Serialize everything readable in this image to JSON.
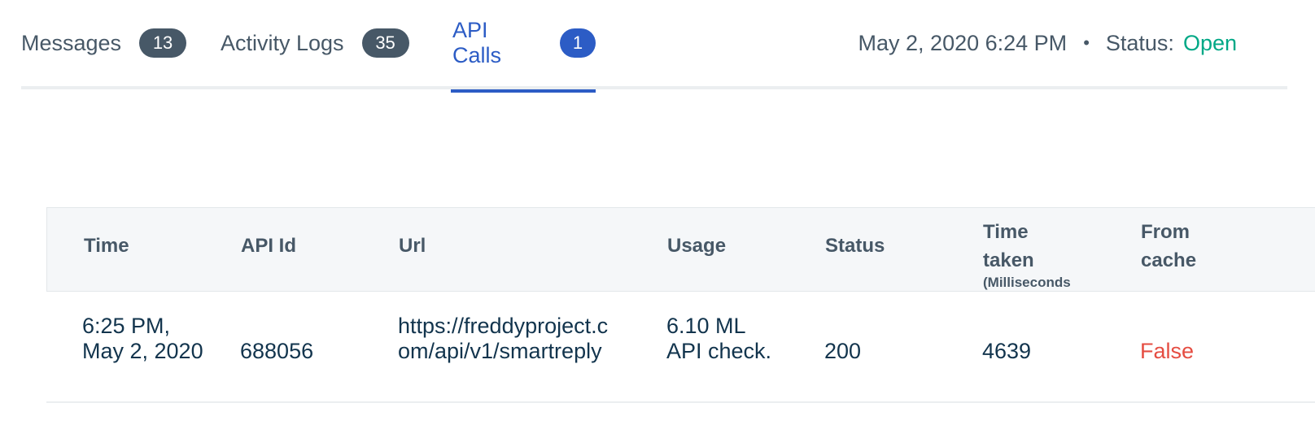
{
  "tabs": [
    {
      "label": "Messages",
      "count": "13"
    },
    {
      "label": "Activity Logs",
      "count": "35"
    },
    {
      "label": "API Calls",
      "count": "1"
    }
  ],
  "active_tab": "API Calls",
  "meta": {
    "datetime": "May 2, 2020 6:24 PM",
    "separator": "•",
    "status_label": "Status:",
    "status_value": "Open"
  },
  "colors": {
    "accent": "#2c5cc5",
    "status_open": "#00a886",
    "false_value": "#e54d42",
    "badge": "#475867"
  },
  "table": {
    "headers": {
      "time": "Time",
      "api_id": "API Id",
      "url": "Url",
      "usage": "Usage",
      "status": "Status",
      "time_taken": "Time taken",
      "time_taken_unit": "(Milliseconds",
      "from_cache": "From cache"
    },
    "rows": [
      {
        "time": "6:25 PM, May 2, 2020",
        "api_id": "688056",
        "url": "https://freddyproject.com/api/v1/smartreply",
        "usage": "6.10 ML API check.",
        "status": "200",
        "time_taken": "4639",
        "from_cache": "False"
      }
    ]
  }
}
